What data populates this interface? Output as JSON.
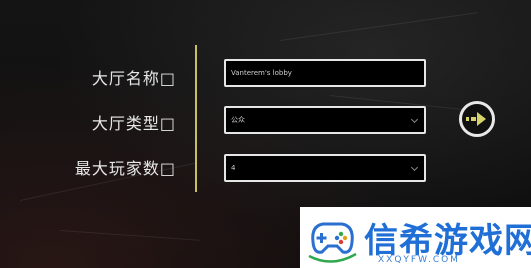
{
  "form": {
    "lobby_name_label": "大厅名称□",
    "lobby_type_label": "大厅类型□",
    "max_players_label": "最大玩家数□",
    "lobby_name_value": "Vanterem's lobby",
    "lobby_type_value": "公众",
    "max_players_value": "4"
  },
  "icons": {
    "dropdown": "chevron-down-icon",
    "submit": "arrow-right-icon",
    "watermark_logo": "gamepad-icon"
  },
  "watermark": {
    "title": "信希游戏网",
    "subtitle": "XXQYFW.COM"
  },
  "colors": {
    "divider": "#c8c060",
    "field_border": "#e6e6e6",
    "watermark_text": "#1f6fd6",
    "arrow": "#d6d26a"
  }
}
